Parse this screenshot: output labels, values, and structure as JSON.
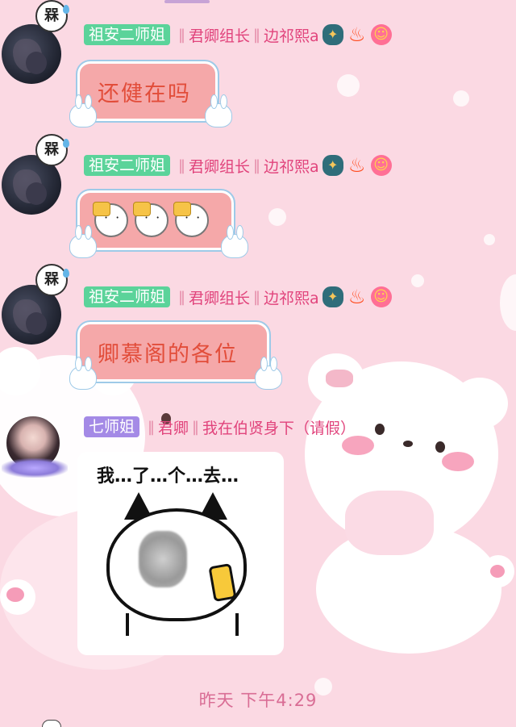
{
  "messages": [
    {
      "sender": "祖安二师姐",
      "title1": "君卿组长",
      "title2": "边祁熙a",
      "pendant": "槑",
      "text": "还健在吗"
    },
    {
      "sender": "祖安二师姐",
      "title1": "君卿组长",
      "title2": "边祁熙a",
      "pendant": "槑",
      "emoji_count": 3
    },
    {
      "sender": "祖安二师姐",
      "title1": "君卿组长",
      "title2": "边祁熙a",
      "pendant": "槑",
      "text": "卿慕阁的各位"
    },
    {
      "sender": "七师姐",
      "title1": "君卿",
      "title2": "我在伯贤身下（请假）",
      "sticker_text": "我…了…个…去…"
    }
  ],
  "timestamp": "昨天 下午4:29",
  "colors": {
    "background": "#fbd9e3",
    "bubble": "#f5a8a9",
    "bubble_text": "#e24d3a",
    "name_text": "#e1447c",
    "tag_green": "#5bd39a",
    "tag_purple": "#a48ae6"
  },
  "icons": [
    "dragon-badge-icon",
    "fire-icon",
    "smiley-icon"
  ]
}
